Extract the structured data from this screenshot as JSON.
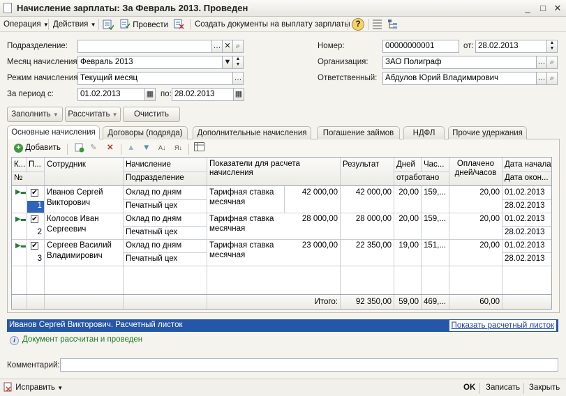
{
  "window": {
    "title": "Начисление зарплаты: За Февраль 2013. Проведен",
    "min": "_",
    "max": "□",
    "close": "✕"
  },
  "toolbar": {
    "operation": "Операция",
    "actions": "Действия",
    "post": "Провести",
    "create_docs": "Создать документы на выплату зарплаты",
    "help": "?"
  },
  "form": {
    "department_label": "Подразделение:",
    "department_value": "",
    "month_label": "Месяц начисления:",
    "month_value": "Февраль 2013",
    "mode_label": "Режим начисления:",
    "mode_value": "Текущий месяц",
    "period_label": "За период с:",
    "period_from": "01.02.2013",
    "period_to_label": "по:",
    "period_to": "28.02.2013",
    "number_label": "Номер:",
    "number_value": "00000000001",
    "date_label": "от:",
    "date_value": "28.02.2013",
    "org_label": "Организация:",
    "org_value": "ЗАО Полиграф",
    "resp_label": "Ответственный:",
    "resp_value": "Абдулов Юрий Владимирович"
  },
  "buttons": {
    "fill": "Заполнить",
    "calculate": "Рассчитать",
    "clear": "Очистить"
  },
  "tabs": [
    {
      "label": "Основные начисления"
    },
    {
      "label": "Договоры (подряда)"
    },
    {
      "label": "Дополнительные начисления"
    },
    {
      "label": "Погашение займов"
    },
    {
      "label": "НДФЛ"
    },
    {
      "label": "Прочие удержания"
    }
  ],
  "tab_toolbar": {
    "add": "Добавить"
  },
  "table": {
    "headers": {
      "k": "К...",
      "p": "П...",
      "num": "№",
      "employee": "Сотрудник",
      "accrual": "Начисление",
      "department": "Подразделение",
      "indicators": "Показатели для расчета начисления",
      "result": "Результат",
      "days": "Дней",
      "worked": "отработано",
      "hours": "Час...",
      "paid": "Оплачено дней/часов",
      "start": "Дата начала",
      "end": "Дата окон..."
    },
    "rows": [
      {
        "num": "1",
        "employee": "Иванов Сергей Викторович",
        "accrual": "Оклад по дням",
        "department": "Печатный цех",
        "indicator": "Тарифная ставка месячная",
        "indicator_value": "42 000,00",
        "result": "42 000,00",
        "days": "20,00",
        "hours": "159,...",
        "paid": "20,00",
        "start": "01.02.2013",
        "end": "28.02.2013"
      },
      {
        "num": "2",
        "employee": "Колосов Иван Сергеевич",
        "accrual": "Оклад по дням",
        "department": "Печатный цех",
        "indicator": "Тарифная ставка месячная",
        "indicator_value": "28 000,00",
        "result": "28 000,00",
        "days": "20,00",
        "hours": "159,...",
        "paid": "20,00",
        "start": "01.02.2013",
        "end": "28.02.2013"
      },
      {
        "num": "3",
        "employee": "Сергеев Василий Владимирович",
        "accrual": "Оклад по дням",
        "department": "Печатный цех",
        "indicator": "Тарифная ставка месячная",
        "indicator_value": "23 000,00",
        "result": "22 350,00",
        "days": "19,00",
        "hours": "151,...",
        "paid": "20,00",
        "start": "01.02.2013",
        "end": "28.02.2013"
      }
    ],
    "totals": {
      "label": "Итого:",
      "result": "92 350,00",
      "days": "59,00",
      "hours": "469,...",
      "paid": "60,00"
    }
  },
  "status": {
    "title": "Иванов Сергей Викторович. Расчетный листок",
    "link": "Показать расчетный листок"
  },
  "info": "Документ рассчитан и проведен",
  "comment_label": "Комментарий:",
  "comment_value": "",
  "bottom": {
    "fix": "Исправить",
    "ok": "OK",
    "save": "Записать",
    "close": "Закрыть"
  }
}
